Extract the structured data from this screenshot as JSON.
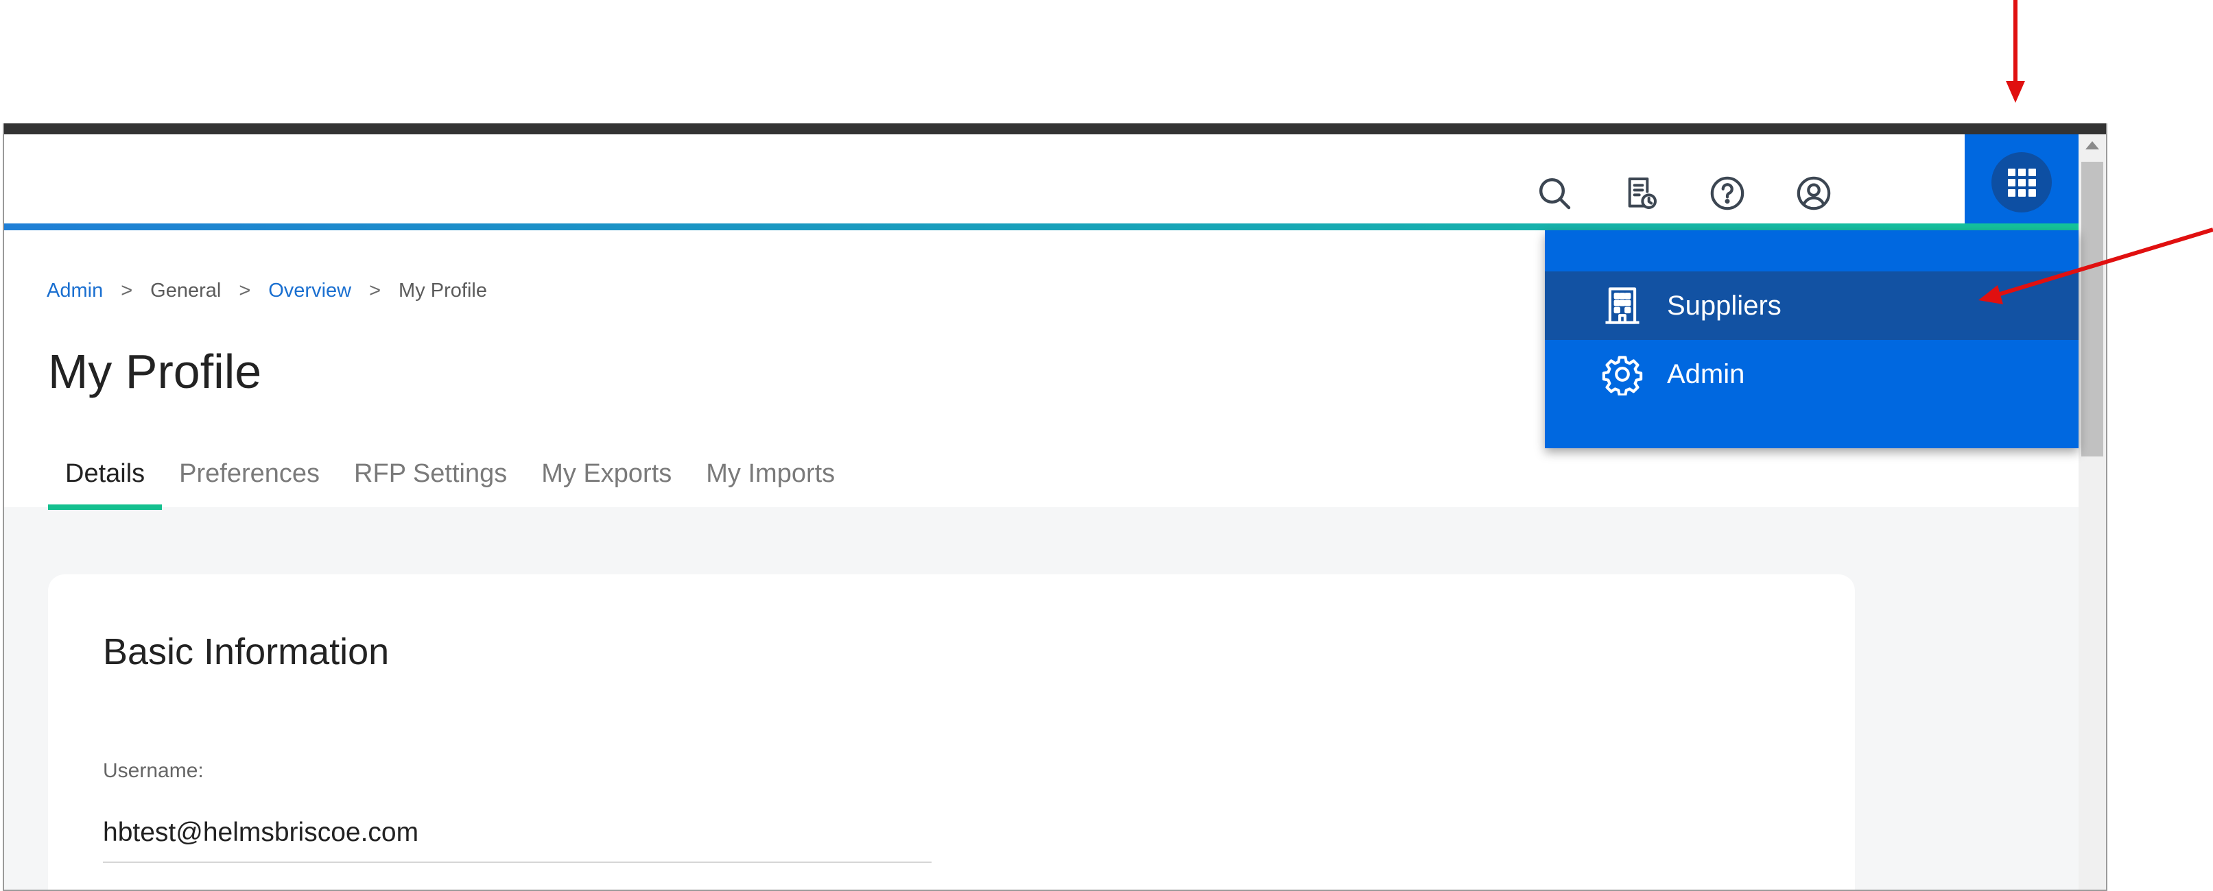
{
  "breadcrumb": {
    "items": [
      {
        "label": "Admin",
        "link": true
      },
      {
        "label": "General",
        "link": false
      },
      {
        "label": "Overview",
        "link": true
      },
      {
        "label": "My Profile",
        "link": false
      }
    ],
    "separator": ">"
  },
  "page": {
    "title": "My Profile"
  },
  "tabs": [
    {
      "label": "Details",
      "active": true
    },
    {
      "label": "Preferences",
      "active": false
    },
    {
      "label": "RFP Settings",
      "active": false
    },
    {
      "label": "My Exports",
      "active": false
    },
    {
      "label": "My Imports",
      "active": false
    }
  ],
  "card": {
    "title": "Basic Information",
    "username_label": "Username:",
    "username_value": "hbtest@helmsbriscoe.com"
  },
  "header_icons": [
    "search-icon",
    "report-history-icon",
    "help-icon",
    "account-icon",
    "apps-grid-icon"
  ],
  "app_menu": {
    "items": [
      {
        "label": "Suppliers",
        "icon": "building-icon",
        "highlighted": true
      },
      {
        "label": "Admin",
        "icon": "gear-icon",
        "highlighted": false
      }
    ]
  },
  "colors": {
    "menu_blue": "#0068e0",
    "menu_highlight": "#1252a3",
    "tab_underline": "#14c08f",
    "link_blue": "#1a6fd0",
    "annotation_red": "#e01010"
  }
}
